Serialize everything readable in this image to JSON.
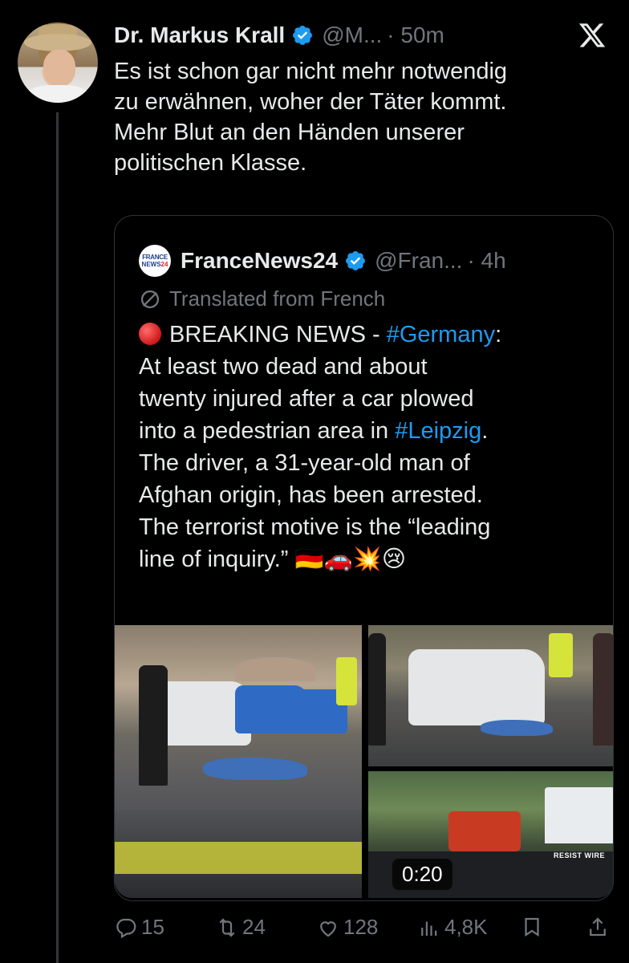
{
  "tweet": {
    "author_name": "Dr. Markus Krall",
    "handle": "@M...",
    "time": "· 50m",
    "text_lines": [
      "Es ist schon gar nicht mehr notwendig",
      "zu erwähnen, woher der Täter kommt.",
      "Mehr Blut an den Händen unserer",
      "politischen Klasse."
    ]
  },
  "quote": {
    "avatar_line1": "FRANCE",
    "avatar_line2": "NEWS",
    "avatar_line2_num": "24",
    "author_name": "FranceNews24",
    "handle": "@Fran...",
    "time": "· 4h",
    "translated_label": "Translated from French",
    "line1_text": "BREAKING NEWS - ",
    "line1_hashtag": "#Germany",
    "line1_suffix": ":",
    "line2": "At least two dead and about",
    "line3": "twenty injured after a car plowed",
    "line4_text": "into a pedestrian area in ",
    "line4_hashtag": "#Leipzig",
    "line4_suffix": ".",
    "line5": "The driver, a 31-year-old man of",
    "line6": "Afghan origin, has been arrested.",
    "line7": "The terrorist motive is the “leading",
    "line8": "line of inquiry.” 🇩🇪🚗💥😢",
    "video_duration": "0:20",
    "watermark": "RESIST WIRE"
  },
  "actions": {
    "replies": "15",
    "reposts": "24",
    "likes": "128",
    "views": "4,8K"
  },
  "colors": {
    "background": "#000000",
    "text": "#e7e9ea",
    "muted": "#71767b",
    "link": "#1d9bf0",
    "verified": "#1d9bf0"
  },
  "icons": [
    "x-logo-icon",
    "verified-badge-icon",
    "translate-globe-icon",
    "reply-icon",
    "repost-icon",
    "like-icon",
    "views-icon",
    "bookmark-icon",
    "share-icon"
  ]
}
